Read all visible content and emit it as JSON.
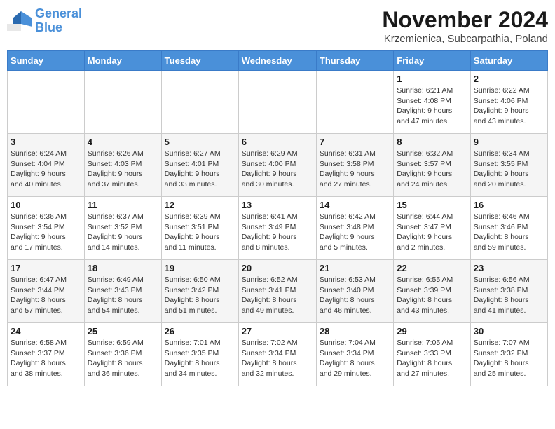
{
  "header": {
    "logo_general": "General",
    "logo_blue": "Blue",
    "month_title": "November 2024",
    "location": "Krzemienica, Subcarpathia, Poland"
  },
  "weekdays": [
    "Sunday",
    "Monday",
    "Tuesday",
    "Wednesday",
    "Thursday",
    "Friday",
    "Saturday"
  ],
  "weeks": [
    [
      {
        "day": "",
        "info": ""
      },
      {
        "day": "",
        "info": ""
      },
      {
        "day": "",
        "info": ""
      },
      {
        "day": "",
        "info": ""
      },
      {
        "day": "",
        "info": ""
      },
      {
        "day": "1",
        "info": "Sunrise: 6:21 AM\nSunset: 4:08 PM\nDaylight: 9 hours\nand 47 minutes."
      },
      {
        "day": "2",
        "info": "Sunrise: 6:22 AM\nSunset: 4:06 PM\nDaylight: 9 hours\nand 43 minutes."
      }
    ],
    [
      {
        "day": "3",
        "info": "Sunrise: 6:24 AM\nSunset: 4:04 PM\nDaylight: 9 hours\nand 40 minutes."
      },
      {
        "day": "4",
        "info": "Sunrise: 6:26 AM\nSunset: 4:03 PM\nDaylight: 9 hours\nand 37 minutes."
      },
      {
        "day": "5",
        "info": "Sunrise: 6:27 AM\nSunset: 4:01 PM\nDaylight: 9 hours\nand 33 minutes."
      },
      {
        "day": "6",
        "info": "Sunrise: 6:29 AM\nSunset: 4:00 PM\nDaylight: 9 hours\nand 30 minutes."
      },
      {
        "day": "7",
        "info": "Sunrise: 6:31 AM\nSunset: 3:58 PM\nDaylight: 9 hours\nand 27 minutes."
      },
      {
        "day": "8",
        "info": "Sunrise: 6:32 AM\nSunset: 3:57 PM\nDaylight: 9 hours\nand 24 minutes."
      },
      {
        "day": "9",
        "info": "Sunrise: 6:34 AM\nSunset: 3:55 PM\nDaylight: 9 hours\nand 20 minutes."
      }
    ],
    [
      {
        "day": "10",
        "info": "Sunrise: 6:36 AM\nSunset: 3:54 PM\nDaylight: 9 hours\nand 17 minutes."
      },
      {
        "day": "11",
        "info": "Sunrise: 6:37 AM\nSunset: 3:52 PM\nDaylight: 9 hours\nand 14 minutes."
      },
      {
        "day": "12",
        "info": "Sunrise: 6:39 AM\nSunset: 3:51 PM\nDaylight: 9 hours\nand 11 minutes."
      },
      {
        "day": "13",
        "info": "Sunrise: 6:41 AM\nSunset: 3:49 PM\nDaylight: 9 hours\nand 8 minutes."
      },
      {
        "day": "14",
        "info": "Sunrise: 6:42 AM\nSunset: 3:48 PM\nDaylight: 9 hours\nand 5 minutes."
      },
      {
        "day": "15",
        "info": "Sunrise: 6:44 AM\nSunset: 3:47 PM\nDaylight: 9 hours\nand 2 minutes."
      },
      {
        "day": "16",
        "info": "Sunrise: 6:46 AM\nSunset: 3:46 PM\nDaylight: 8 hours\nand 59 minutes."
      }
    ],
    [
      {
        "day": "17",
        "info": "Sunrise: 6:47 AM\nSunset: 3:44 PM\nDaylight: 8 hours\nand 57 minutes."
      },
      {
        "day": "18",
        "info": "Sunrise: 6:49 AM\nSunset: 3:43 PM\nDaylight: 8 hours\nand 54 minutes."
      },
      {
        "day": "19",
        "info": "Sunrise: 6:50 AM\nSunset: 3:42 PM\nDaylight: 8 hours\nand 51 minutes."
      },
      {
        "day": "20",
        "info": "Sunrise: 6:52 AM\nSunset: 3:41 PM\nDaylight: 8 hours\nand 49 minutes."
      },
      {
        "day": "21",
        "info": "Sunrise: 6:53 AM\nSunset: 3:40 PM\nDaylight: 8 hours\nand 46 minutes."
      },
      {
        "day": "22",
        "info": "Sunrise: 6:55 AM\nSunset: 3:39 PM\nDaylight: 8 hours\nand 43 minutes."
      },
      {
        "day": "23",
        "info": "Sunrise: 6:56 AM\nSunset: 3:38 PM\nDaylight: 8 hours\nand 41 minutes."
      }
    ],
    [
      {
        "day": "24",
        "info": "Sunrise: 6:58 AM\nSunset: 3:37 PM\nDaylight: 8 hours\nand 38 minutes."
      },
      {
        "day": "25",
        "info": "Sunrise: 6:59 AM\nSunset: 3:36 PM\nDaylight: 8 hours\nand 36 minutes."
      },
      {
        "day": "26",
        "info": "Sunrise: 7:01 AM\nSunset: 3:35 PM\nDaylight: 8 hours\nand 34 minutes."
      },
      {
        "day": "27",
        "info": "Sunrise: 7:02 AM\nSunset: 3:34 PM\nDaylight: 8 hours\nand 32 minutes."
      },
      {
        "day": "28",
        "info": "Sunrise: 7:04 AM\nSunset: 3:34 PM\nDaylight: 8 hours\nand 29 minutes."
      },
      {
        "day": "29",
        "info": "Sunrise: 7:05 AM\nSunset: 3:33 PM\nDaylight: 8 hours\nand 27 minutes."
      },
      {
        "day": "30",
        "info": "Sunrise: 7:07 AM\nSunset: 3:32 PM\nDaylight: 8 hours\nand 25 minutes."
      }
    ]
  ]
}
